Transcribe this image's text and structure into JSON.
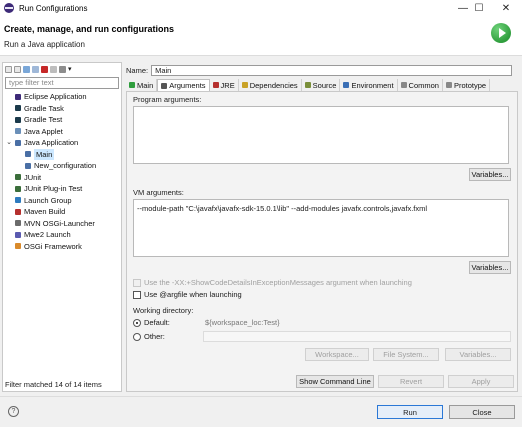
{
  "window": {
    "title": "Run Configurations"
  },
  "header": {
    "title": "Create, manage, and run configurations",
    "subtitle": "Run a Java application"
  },
  "filter": {
    "placeholder": "type filter text",
    "status": "Filter matched 14 of 14 items"
  },
  "tree": [
    {
      "label": "Eclipse Application",
      "icon": "eclipse-icon",
      "color": "#3d2a78",
      "level": 1
    },
    {
      "label": "Gradle Task",
      "icon": "gradle-icon",
      "color": "#1b3a4b",
      "level": 1
    },
    {
      "label": "Gradle Test",
      "icon": "gradle-icon",
      "color": "#1b3a4b",
      "level": 1
    },
    {
      "label": "Java Applet",
      "icon": "applet-icon",
      "color": "#6a8fb8",
      "level": 1
    },
    {
      "label": "Java Application",
      "icon": "java-app-icon",
      "color": "#4a6fa5",
      "level": 1,
      "expanded": true
    },
    {
      "label": "Main",
      "icon": "java-config-icon",
      "color": "#4a6fa5",
      "level": 2,
      "selected": true
    },
    {
      "label": "New_configuration",
      "icon": "java-config-icon",
      "color": "#4a6fa5",
      "level": 2
    },
    {
      "label": "JUnit",
      "icon": "junit-icon",
      "color": "#3b6e3b",
      "level": 1
    },
    {
      "label": "JUnit Plug-in Test",
      "icon": "junit-plugin-icon",
      "color": "#3b6e3b",
      "level": 1
    },
    {
      "label": "Launch Group",
      "icon": "launch-group-icon",
      "color": "#2e7bbf",
      "level": 1
    },
    {
      "label": "Maven Build",
      "icon": "maven-icon",
      "color": "#b5302e",
      "level": 1
    },
    {
      "label": "MVN OSGi-Launcher",
      "icon": "mvn-osgi-icon",
      "color": "#6b6b6b",
      "level": 1
    },
    {
      "label": "Mwe2 Launch",
      "icon": "mwe2-icon",
      "color": "#5a5ab0",
      "level": 1
    },
    {
      "label": "OSGi Framework",
      "icon": "osgi-icon",
      "color": "#d98a2b",
      "level": 1
    }
  ],
  "config": {
    "name_label": "Name:",
    "name_value": "Main"
  },
  "tabs": [
    {
      "label": "Main",
      "icon": "main-tab-icon",
      "color": "#2f9e3d"
    },
    {
      "label": "Arguments",
      "icon": "arguments-tab-icon",
      "color": "#555555",
      "active": true
    },
    {
      "label": "JRE",
      "icon": "jre-tab-icon",
      "color": "#b5302e"
    },
    {
      "label": "Dependencies",
      "icon": "dependencies-tab-icon",
      "color": "#c9a227"
    },
    {
      "label": "Source",
      "icon": "source-tab-icon",
      "color": "#7a8f3a"
    },
    {
      "label": "Environment",
      "icon": "environment-tab-icon",
      "color": "#3a6fb5"
    },
    {
      "label": "Common",
      "icon": "common-tab-icon",
      "color": "#888888"
    },
    {
      "label": "Prototype",
      "icon": "prototype-tab-icon",
      "color": "#888888"
    }
  ],
  "arguments": {
    "program_label": "Program arguments:",
    "program_value": "",
    "variables_label": "Variables...",
    "vm_label": "VM arguments:",
    "vm_value": "--module-path \"C:\\javafx\\javafx-sdk-15.0.1\\lib\" --add-modules javafx.controls,javafx.fxml",
    "show_code_details": "Use the -XX:+ShowCodeDetailsInExceptionMessages argument when launching",
    "argfile": "Use @argfile when launching",
    "working_dir_label": "Working directory:",
    "default_label": "Default:",
    "default_value": "${workspace_loc:Test}",
    "other_label": "Other:",
    "workspace_btn": "Workspace...",
    "filesystem_btn": "File System...",
    "wd_variables_btn": "Variables..."
  },
  "actions": {
    "show_command_line": "Show Command Line",
    "revert": "Revert",
    "apply": "Apply"
  },
  "footer": {
    "run": "Run",
    "close": "Close",
    "help": "?"
  }
}
